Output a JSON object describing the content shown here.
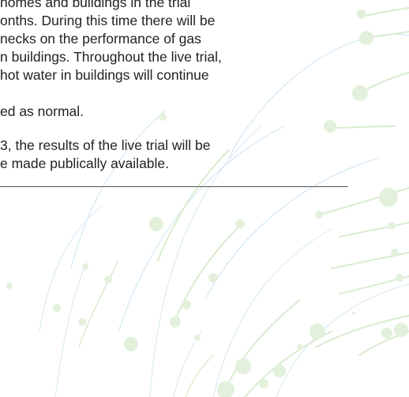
{
  "paragraph_1": {
    "lines": [
      "homes and buildings in the trial",
      "onths. During this time there will be",
      "necks on the performance of gas",
      "n buildings. Throughout the live trial,",
      "hot water in buildings will continue",
      "ed as normal."
    ]
  },
  "paragraph_2": {
    "lines": [
      "3, the results of the live trial will be",
      "e made publically available."
    ]
  },
  "colors": {
    "text": "#222222",
    "rule": "#555555",
    "dot": "#e3f1dc",
    "arc_green": "#d9ecd0",
    "arc_blue": "#d4e8f4"
  }
}
